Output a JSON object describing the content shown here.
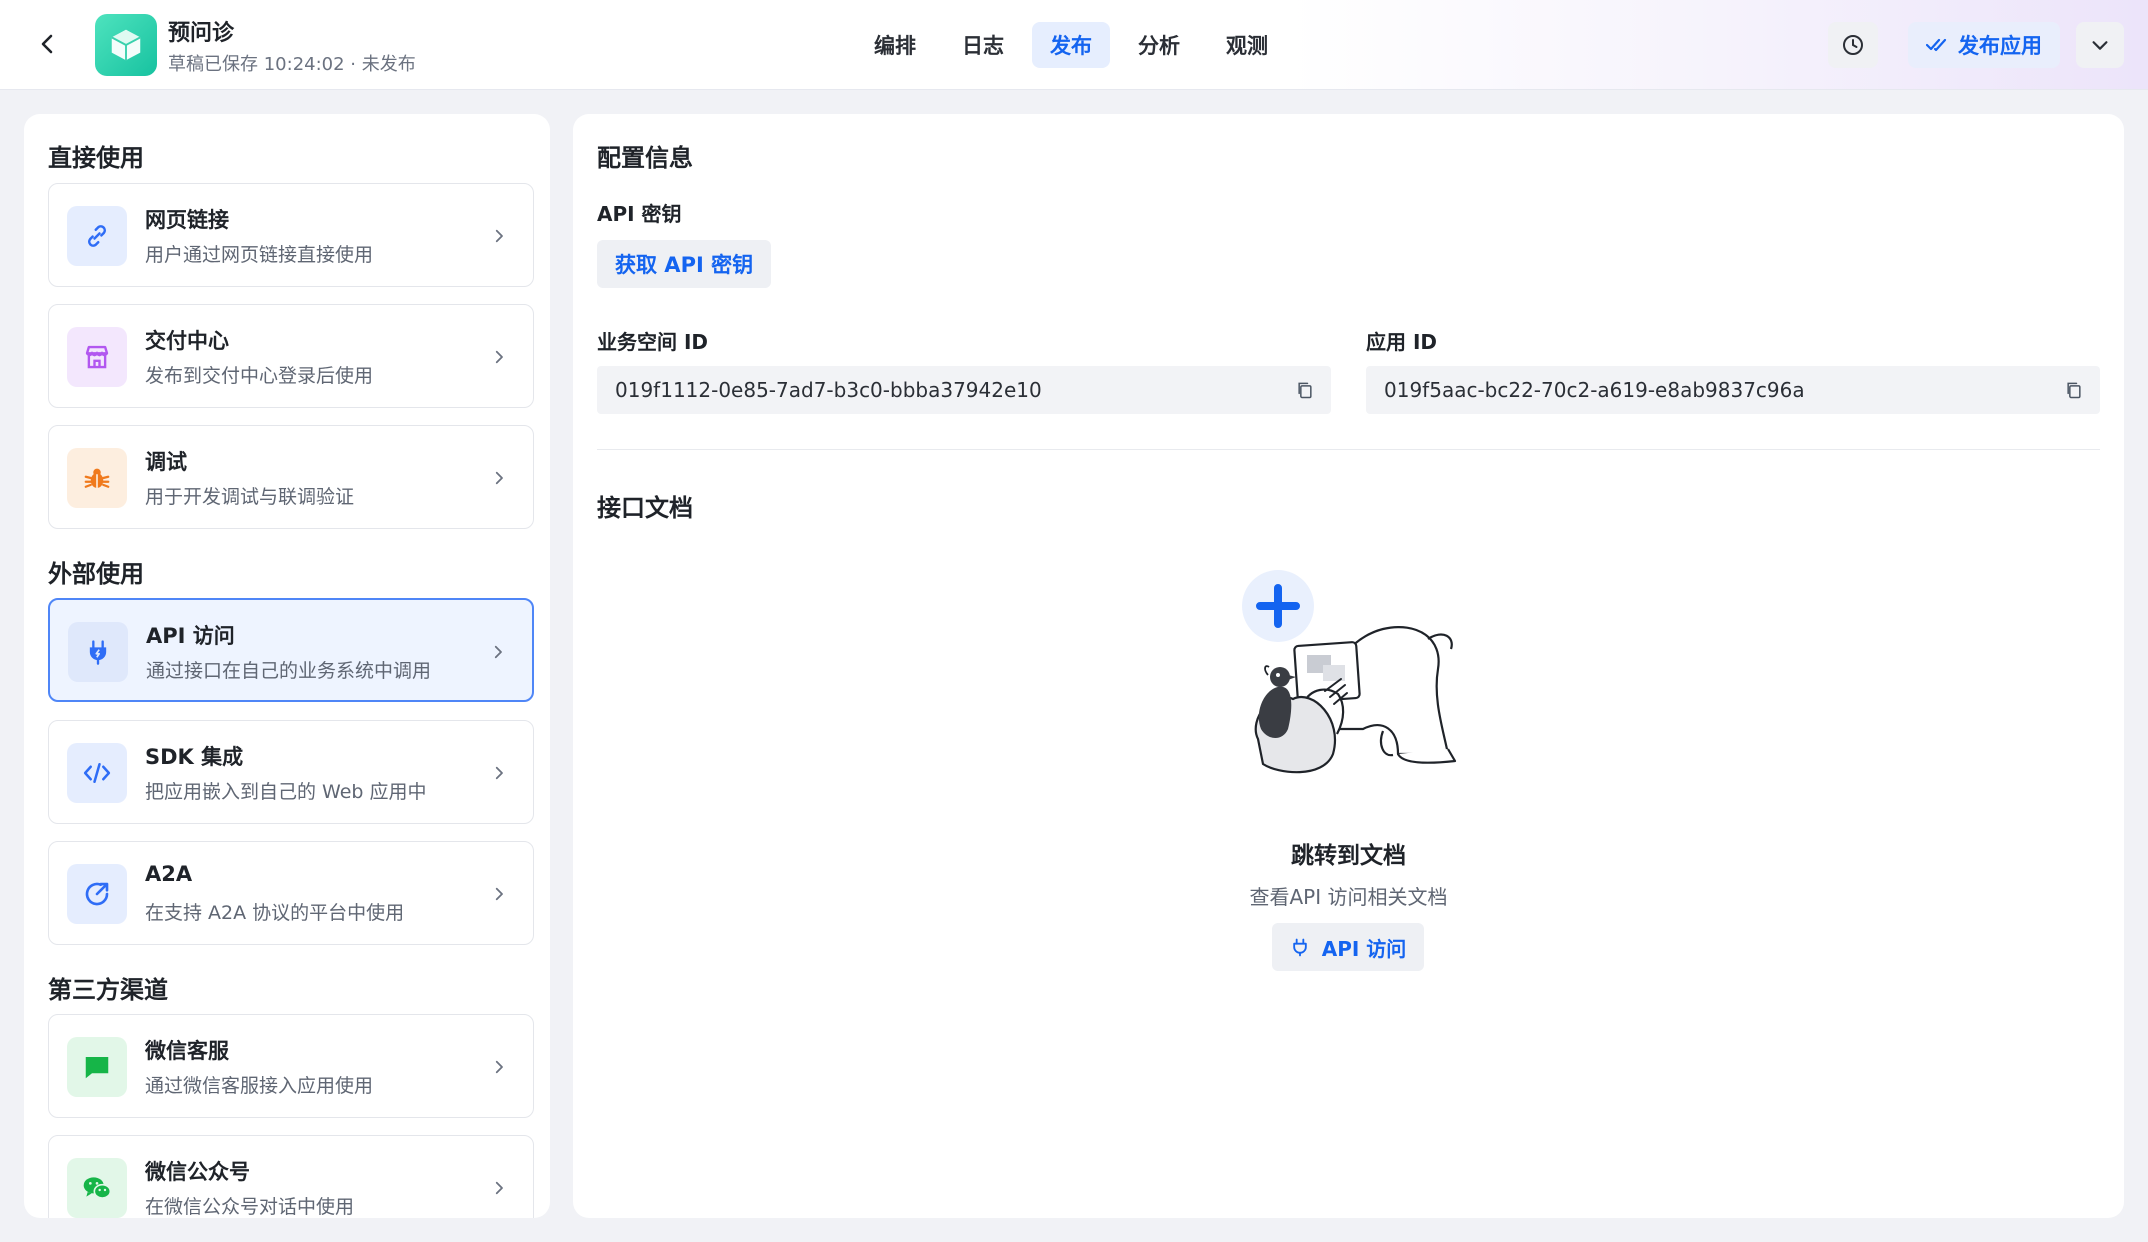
{
  "header": {
    "app_name": "预问诊",
    "status": "草稿已保存 10:24:02 · 未发布",
    "tabs": [
      {
        "label": "编排",
        "active": false
      },
      {
        "label": "日志",
        "active": false
      },
      {
        "label": "发布",
        "active": true
      },
      {
        "label": "分析",
        "active": false
      },
      {
        "label": "观测",
        "active": false
      }
    ],
    "publish_label": "发布应用",
    "icons": {
      "back": "chevron-left-icon",
      "app": "cube-icon",
      "history": "clock-icon",
      "publish": "double-check-icon",
      "more": "chevron-down-icon"
    }
  },
  "sidebar": {
    "sections": [
      {
        "title": "直接使用",
        "items": [
          {
            "title": "网页链接",
            "desc": "用户通过网页链接直接使用",
            "icon": "link-icon",
            "color": "#2f6df6",
            "bg": "#e5edfe"
          },
          {
            "title": "交付中心",
            "desc": "发布到交付中心登录后使用",
            "icon": "store-icon",
            "color": "#b257f0",
            "bg": "#f3e7fd"
          },
          {
            "title": "调试",
            "desc": "用于开发调试与联调验证",
            "icon": "bug-icon",
            "color": "#f07a1d",
            "bg": "#fdeedf"
          }
        ]
      },
      {
        "title": "外部使用",
        "items": [
          {
            "title": "API 访问",
            "desc": "通过接口在自己的业务系统中调用",
            "icon": "plug-icon",
            "color": "#2f6df6",
            "bg": "#dfe8fb",
            "selected": true
          },
          {
            "title": "SDK 集成",
            "desc": "把应用嵌入到自己的 Web 应用中",
            "icon": "code-icon",
            "color": "#2f6df6",
            "bg": "#e5edfe"
          },
          {
            "title": "A2A",
            "desc": "在支持 A2A 协议的平台中使用",
            "icon": "share-arrow-icon",
            "color": "#2f6df6",
            "bg": "#e5edfe"
          }
        ]
      },
      {
        "title": "第三方渠道",
        "items": [
          {
            "title": "微信客服",
            "desc": "通过微信客服接入应用使用",
            "icon": "chat-bubble-icon",
            "color": "#16b548",
            "bg": "#e2f7e8"
          },
          {
            "title": "微信公众号",
            "desc": "在微信公众号对话中使用",
            "icon": "wechat-icon",
            "color": "#16b548",
            "bg": "#e2f7e8"
          }
        ]
      }
    ]
  },
  "config": {
    "heading": "配置信息",
    "api_key_label": "API 密钥",
    "get_key_button": "获取 API 密钥",
    "workspace_id_label": "业务空间 ID",
    "workspace_id": "019f1112-0e85-7ad7-b3c0-bbba37942e10",
    "app_id_label": "应用 ID",
    "app_id": "019f5aac-bc22-70c2-a619-e8ab9837c96a"
  },
  "docs": {
    "heading": "接口文档",
    "title": "跳转到文档",
    "subtitle": "查看API 访问相关文档",
    "button": "API 访问"
  }
}
